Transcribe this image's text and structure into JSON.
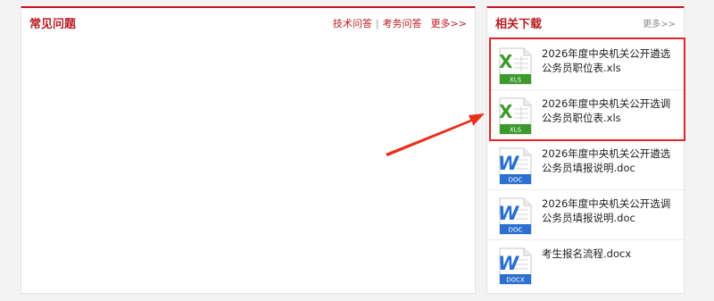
{
  "faq": {
    "title": "常见问题",
    "links": [
      "技术问答",
      "考务问答"
    ],
    "more": "更多>>"
  },
  "downloads": {
    "title": "相关下载",
    "more": "更多>>",
    "files": [
      {
        "name": "2026年度中央机关公开遴选公务员职位表.xls",
        "icon": "xls-file-icon",
        "type_label": "XLS"
      },
      {
        "name": "2026年度中央机关公开选调公务员职位表.xls",
        "icon": "xls-file-icon",
        "type_label": "XLS"
      },
      {
        "name": "2026年度中央机关公开遴选公务员填报说明.doc",
        "icon": "doc-file-icon",
        "type_label": "DOC"
      },
      {
        "name": "2026年度中央机关公开选调公务员填报说明.doc",
        "icon": "doc-file-icon",
        "type_label": "DOC"
      },
      {
        "name": "考生报名流程.docx",
        "icon": "docx-file-icon",
        "type_label": "DOCX"
      }
    ]
  },
  "colors": {
    "accent": "#c8141b",
    "highlight": "#e5232a",
    "xls": "#3c9a2d",
    "doc": "#2b6fd0"
  }
}
